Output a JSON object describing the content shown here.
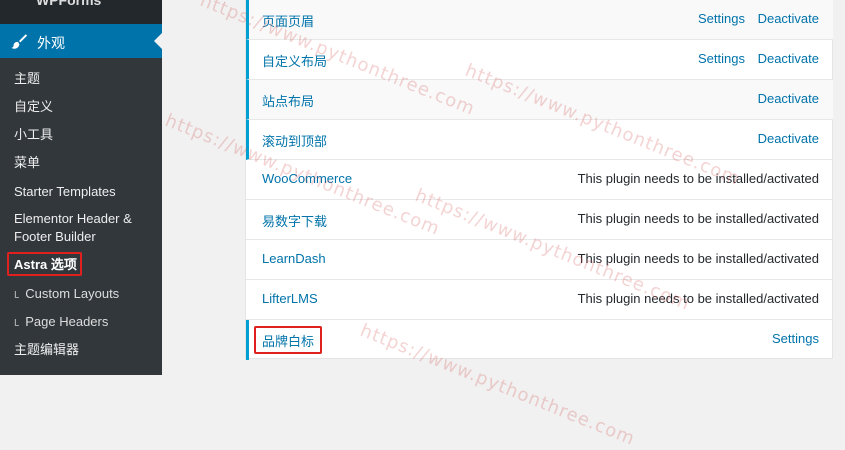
{
  "sidebar": {
    "top_item": "WPForms",
    "active_menu": "外观",
    "items": [
      {
        "label": "主题",
        "indent": false
      },
      {
        "label": "自定义",
        "indent": false
      },
      {
        "label": "小工具",
        "indent": false
      },
      {
        "label": "菜单",
        "indent": false
      },
      {
        "label": "Starter Templates",
        "indent": false
      },
      {
        "label": "Elementor Header &",
        "indent": false
      },
      {
        "label": "Footer Builder",
        "indent": false
      },
      {
        "label": "Astra 选项",
        "indent": false,
        "highlighted": true
      },
      {
        "label": "Custom Layouts",
        "indent": true
      },
      {
        "label": "Page Headers",
        "indent": true
      },
      {
        "label": "主题编辑器",
        "indent": false
      }
    ]
  },
  "modules": [
    {
      "name": "页面页眉",
      "settings": "Settings",
      "deactivate": "Deactivate",
      "status": "active"
    },
    {
      "name": "自定义布局",
      "settings": "Settings",
      "deactivate": "Deactivate",
      "status": "active"
    },
    {
      "name": "站点布局",
      "deactivate": "Deactivate",
      "status": "active"
    },
    {
      "name": "滚动到顶部",
      "deactivate": "Deactivate",
      "status": "active"
    },
    {
      "name": "WooCommerce",
      "note": "This plugin needs to be installed/activated",
      "status": "inactive"
    },
    {
      "name": "易数字下载",
      "note": "This plugin needs to be installed/activated",
      "status": "inactive"
    },
    {
      "name": "LearnDash",
      "note": "This plugin needs to be installed/activated",
      "status": "inactive"
    },
    {
      "name": "LifterLMS",
      "note": "This plugin needs to be installed/activated",
      "status": "inactive"
    },
    {
      "name": "品牌白标",
      "settings": "Settings",
      "status": "active",
      "highlighted": true
    }
  ],
  "watermark": "https://www.pythonthree.com",
  "colors": {
    "sidebar_bg": "#23282d",
    "submenu_bg": "#32373c",
    "active_menu_bg": "#0073aa",
    "link": "#0073aa",
    "active_border": "#00a0d2",
    "highlight_box": "#e0201e"
  }
}
